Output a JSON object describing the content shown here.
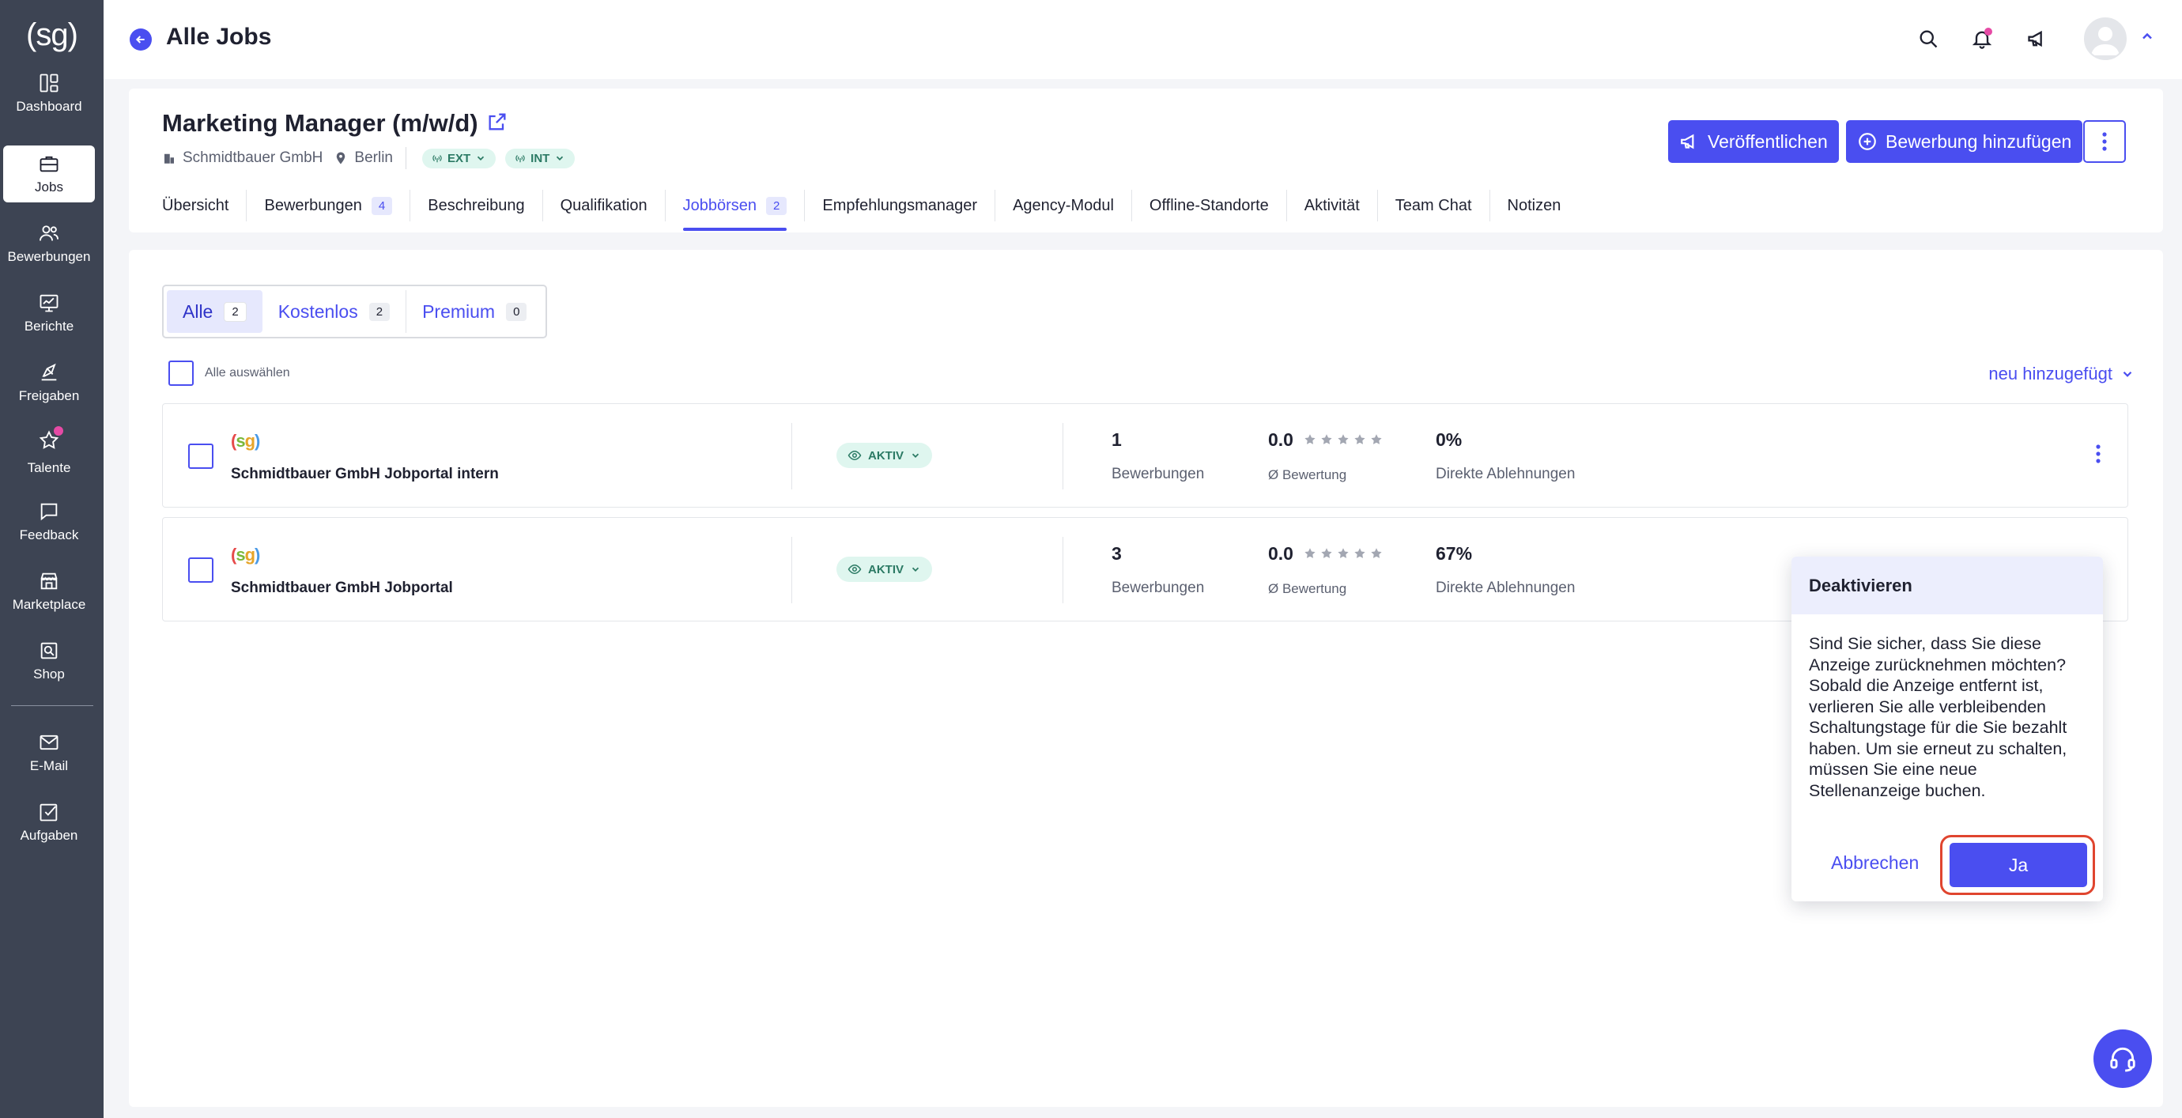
{
  "app": {
    "logo": "(sg)"
  },
  "sidebar": {
    "items": [
      {
        "label": "Dashboard",
        "icon": "dashboard-icon"
      },
      {
        "label": "Jobs",
        "icon": "briefcase-icon",
        "active": true
      },
      {
        "label": "Bewerbungen",
        "icon": "users-icon"
      },
      {
        "label": "Berichte",
        "icon": "chart-icon"
      },
      {
        "label": "Freigaben",
        "icon": "approval-icon"
      },
      {
        "label": "Talente",
        "icon": "star-icon"
      },
      {
        "label": "Feedback",
        "icon": "feedback-icon"
      },
      {
        "label": "Marketplace",
        "icon": "store-icon"
      },
      {
        "label": "Shop",
        "icon": "shop-icon"
      },
      {
        "label": "E-Mail",
        "icon": "mail-icon"
      },
      {
        "label": "Aufgaben",
        "icon": "tasks-icon"
      }
    ]
  },
  "header": {
    "title": "Alle Jobs"
  },
  "job": {
    "title": "Marketing Manager (m/w/d)",
    "company": "Schmidtbauer GmbH",
    "location": "Berlin",
    "badges": [
      "EXT",
      "INT"
    ],
    "publish_label": "Veröffentlichen",
    "add_application_label": "Bewerbung hinzufügen",
    "tabs": [
      {
        "label": "Übersicht"
      },
      {
        "label": "Bewerbungen",
        "count": "4"
      },
      {
        "label": "Beschreibung"
      },
      {
        "label": "Qualifikation"
      },
      {
        "label": "Jobbörsen",
        "count": "2",
        "active": true
      },
      {
        "label": "Empfehlungsmanager"
      },
      {
        "label": "Agency-Modul"
      },
      {
        "label": "Offline-Standorte"
      },
      {
        "label": "Aktivität"
      },
      {
        "label": "Team Chat"
      },
      {
        "label": "Notizen"
      }
    ]
  },
  "filters": {
    "segments": [
      {
        "label": "Alle",
        "count": "2",
        "active": true
      },
      {
        "label": "Kostenlos",
        "count": "2"
      },
      {
        "label": "Premium",
        "count": "0"
      }
    ],
    "select_all_label": "Alle auswählen",
    "sort_label": "neu hinzugefügt"
  },
  "boards": [
    {
      "name": "Schmidtbauer GmbH Jobportal intern",
      "status": "AKTIV",
      "applications": "1",
      "applications_label": "Bewerbungen",
      "rating": "0.0",
      "rating_label": "Ø Bewertung",
      "rejections": "0%",
      "rejections_label": "Direkte Ablehnungen"
    },
    {
      "name": "Schmidtbauer GmbH Jobportal",
      "status": "AKTIV",
      "applications": "3",
      "applications_label": "Bewerbungen",
      "rating": "0.0",
      "rating_label": "Ø Bewertung",
      "rejections": "67%",
      "rejections_label": "Direkte Ablehnungen"
    }
  ],
  "dialog": {
    "title": "Deaktivieren",
    "body": "Sind Sie sicher, dass Sie diese Anzeige zurücknehmen möchten? Sobald die Anzeige entfernt ist, verlieren Sie alle verbleibenden Schaltungstage für die Sie bezahlt haben. Um sie erneut zu schalten, müssen Sie eine neue Stellenanzeige buchen.",
    "cancel_label": "Abbrechen",
    "confirm_label": "Ja"
  },
  "colors": {
    "accent": "#4a4ef0",
    "sidebar": "#3d4453",
    "status_bg": "#dff6ef",
    "highlight_ring": "#e0452f"
  }
}
